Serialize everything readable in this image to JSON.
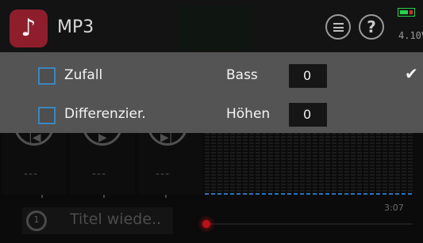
{
  "header": {
    "app_icon": "music-note-icon",
    "title": "MP3",
    "accent_color": "#8e1e2b",
    "battery_voltage": "4.10V",
    "icons": [
      "list-icon",
      "help-icon",
      "battery-icon"
    ]
  },
  "options_panel": {
    "rows": [
      {
        "checkbox_label": "Zufall",
        "checked": false,
        "setting_label": "Bass",
        "setting_value": "0"
      },
      {
        "checkbox_label": "Differenzier.",
        "checked": false,
        "setting_label": "Höhen",
        "setting_value": "0"
      }
    ],
    "confirm_icon": "checkmark-icon",
    "checkbox_border_color": "#3c86bf"
  },
  "player": {
    "controls": [
      "previous-icon",
      "play-icon",
      "next-icon"
    ],
    "placeholders": [
      "---",
      "---",
      "---"
    ],
    "repeat_label": "Titel wiede..",
    "repeat_icon_text": "1",
    "duration": "3:07",
    "progress_fraction": 0.0,
    "progress_color": "#c0101a",
    "spectrum_base_color": "#2c73b7"
  }
}
